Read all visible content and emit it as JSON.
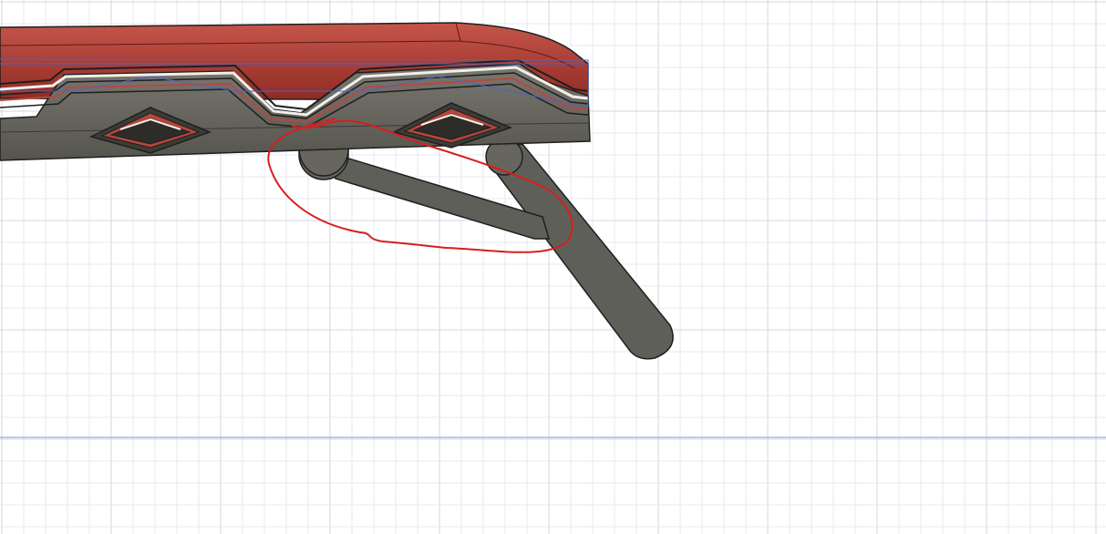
{
  "viewport": {
    "background_color": "#ffffff",
    "grid": {
      "visible": true,
      "minor_line_color": "#e7eaf0",
      "major_line_color": "#d2d7e0"
    },
    "ground_line_color": "#7f8fd6"
  },
  "model": {
    "body_color": "#a8322a",
    "body_highlight_color": "#c6554a",
    "underside_color": "#6b6a62",
    "strut_color": "#5f5f59",
    "edge_color": "#1f1f1f",
    "sketch_line_color": "#4d63c9"
  },
  "annotation": {
    "type": "freehand-circle",
    "color": "#d81e1e"
  }
}
